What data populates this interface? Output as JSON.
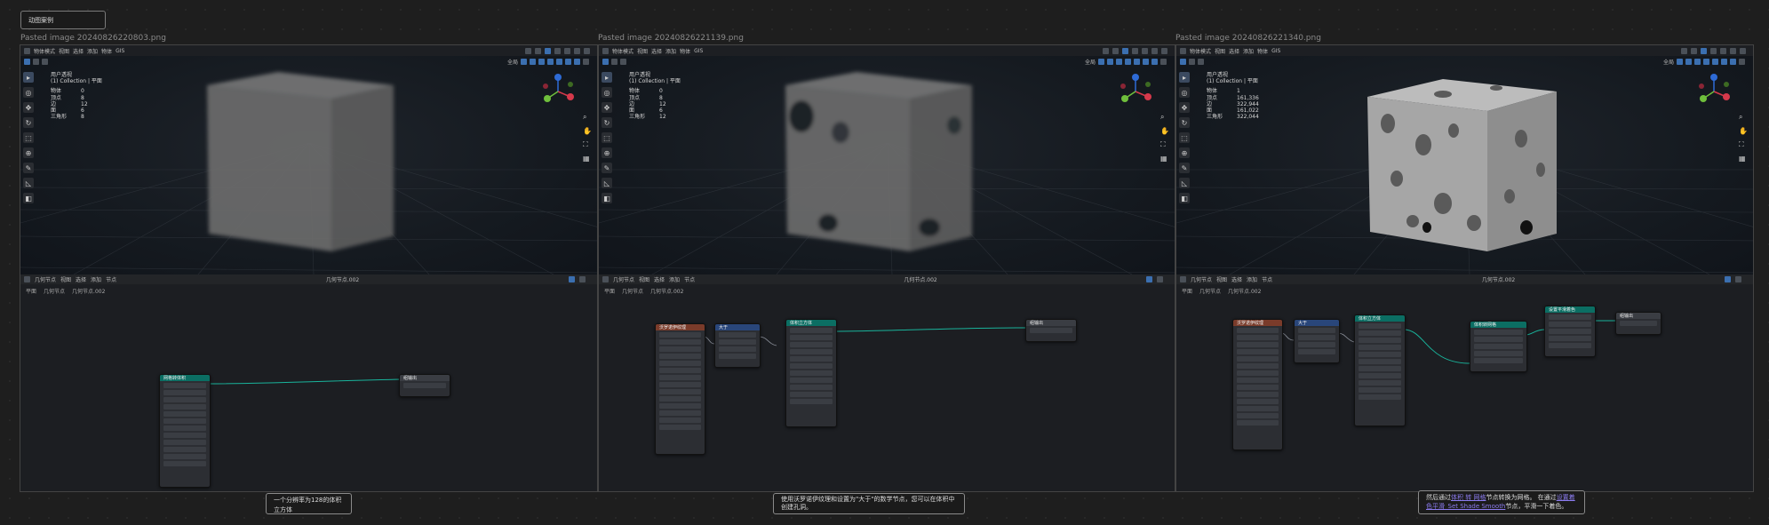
{
  "top_card": {
    "label": "动图案例"
  },
  "panels": [
    {
      "image_title": "Pasted image 20240826220803.png",
      "viewport": {
        "mode": "物体模式",
        "menus": [
          "视图",
          "选择",
          "添加",
          "物体",
          "GIS"
        ],
        "view_name": "用户透视",
        "collection": "(1) Collection | 平面",
        "stats": [
          {
            "k": "物体",
            "v": "0"
          },
          {
            "k": "顶点",
            "v": "8"
          },
          {
            "k": "边",
            "v": "12"
          },
          {
            "k": "面",
            "v": "6"
          },
          {
            "k": "三角形",
            "v": "8"
          }
        ],
        "shading": "全局"
      },
      "node_editor": {
        "editor": "几何节点",
        "menus": [
          "视图",
          "选择",
          "添加",
          "节点"
        ],
        "nodetree": "几何节点.002",
        "breadcrumb": [
          "平面",
          "几何节点",
          "几何节点.002"
        ],
        "nodes": [
          "网格转体积",
          "组输出"
        ]
      },
      "caption": "一个分辨率为128的体积立方体"
    },
    {
      "image_title": "Pasted image 20240826221139.png",
      "viewport": {
        "mode": "物体模式",
        "menus": [
          "视图",
          "选择",
          "添加",
          "物体",
          "GIS"
        ],
        "view_name": "用户透视",
        "collection": "(1) Collection | 平面",
        "stats": [
          {
            "k": "物体",
            "v": "0"
          },
          {
            "k": "顶点",
            "v": "8"
          },
          {
            "k": "边",
            "v": "12"
          },
          {
            "k": "面",
            "v": "6"
          },
          {
            "k": "三角形",
            "v": "12"
          }
        ],
        "shading": "全局"
      },
      "node_editor": {
        "editor": "几何节点",
        "menus": [
          "视图",
          "选择",
          "添加",
          "节点"
        ],
        "nodetree": "几何节点.002",
        "breadcrumb": [
          "平面",
          "几何节点",
          "几何节点.002"
        ],
        "nodes": [
          "沃罗诺伊纹理",
          "大于",
          "体积立方体",
          "组输出"
        ]
      },
      "caption": "使用沃罗诺伊纹理和设置为\"大于\"的数学节点，您可以在体积中创建孔洞。"
    },
    {
      "image_title": "Pasted image 20240826221340.png",
      "viewport": {
        "mode": "物体模式",
        "menus": [
          "视图",
          "选择",
          "添加",
          "物体",
          "GIS"
        ],
        "view_name": "用户透视",
        "collection": "(1) Collection | 平面",
        "stats": [
          {
            "k": "物体",
            "v": "1"
          },
          {
            "k": "顶点",
            "v": "161,336"
          },
          {
            "k": "边",
            "v": "322,944"
          },
          {
            "k": "面",
            "v": "161,022"
          },
          {
            "k": "三角形",
            "v": "322,044"
          }
        ],
        "shading": "全局"
      },
      "node_editor": {
        "editor": "几何节点",
        "menus": [
          "视图",
          "选择",
          "添加",
          "节点"
        ],
        "nodetree": "几何节点.002",
        "breadcrumb": [
          "平面",
          "几何节点",
          "几何节点.002"
        ],
        "nodes": [
          "沃罗诺伊纹理",
          "大于",
          "体积立方体",
          "体积转网格",
          "设置平滑着色",
          "组输出"
        ]
      },
      "caption_parts": {
        "pre": "然后通过",
        "link1": "体积 转 网格",
        "mid": "节点转换为网格。 在通过",
        "link2": "设置着色平滑_Set Shade Smooth",
        "post": "节点，平滑一下着色。"
      }
    }
  ]
}
